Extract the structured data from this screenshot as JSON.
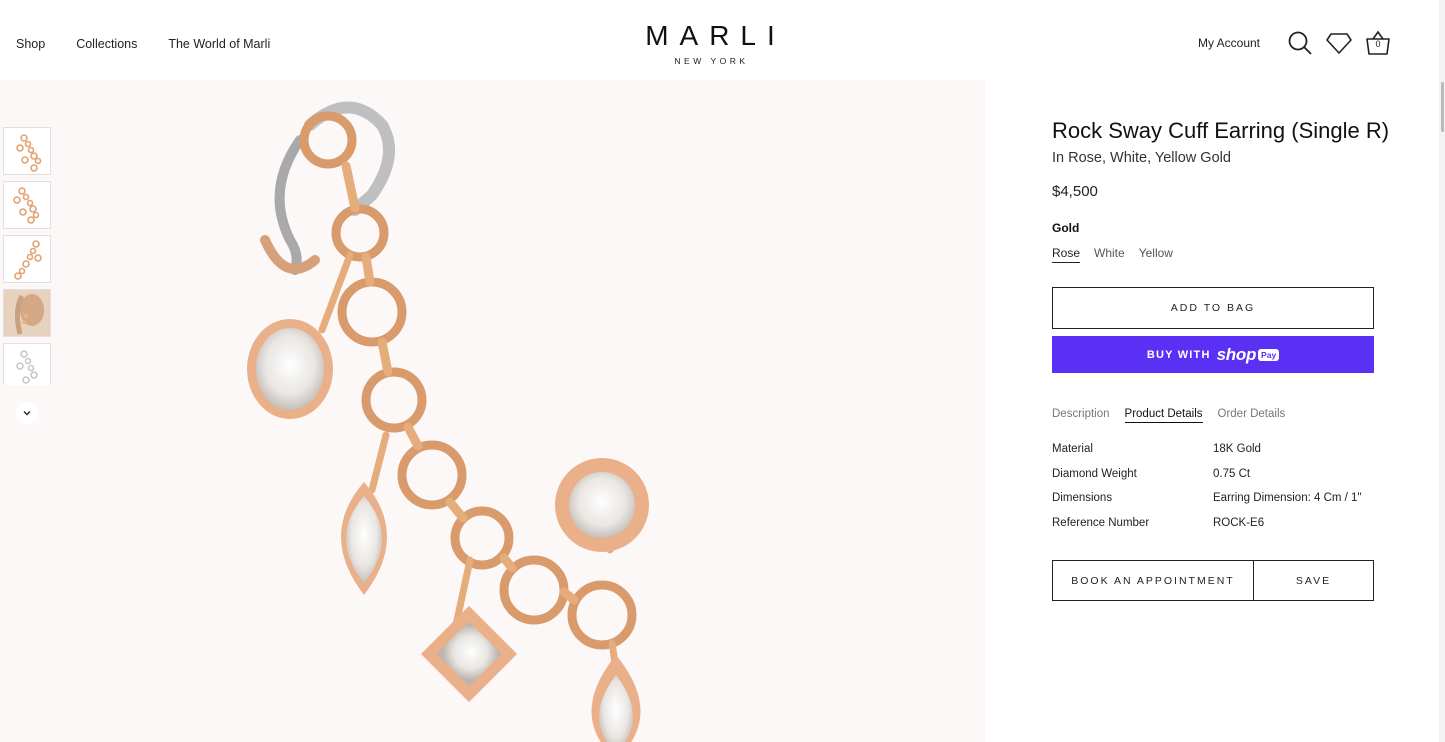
{
  "header": {
    "nav": [
      "Shop",
      "Collections",
      "The World of Marli"
    ],
    "logo": "MARLI",
    "logo_sub": "NEW YORK",
    "my_account": "My Account",
    "cart_count": "0"
  },
  "gallery": {
    "thumbnails": [
      "earring-rose-view",
      "earring-rose-angle",
      "earring-rose-detail",
      "earring-on-model",
      "earring-white-view"
    ],
    "scroll_icon": "chevron-down-icon",
    "main_image": "rock-sway-cuff-earring-rose"
  },
  "product": {
    "title": "Rock Sway Cuff Earring (Single R)",
    "subtitle": "In Rose, White, Yellow Gold",
    "price": "$4,500",
    "variant_label": "Gold",
    "variant_options": [
      "Rose",
      "White",
      "Yellow"
    ],
    "selected_variant": "Rose",
    "add_to_bag": "ADD TO BAG",
    "shop_pay": {
      "prefix": "BUY WITH",
      "brand": "shop",
      "badge": "Pay"
    },
    "tabs": [
      "Description",
      "Product Details",
      "Order Details"
    ],
    "active_tab": "Product Details",
    "details": [
      {
        "label": "Material",
        "value": "18K Gold"
      },
      {
        "label": "Diamond Weight",
        "value": "0.75 Ct"
      },
      {
        "label": "Dimensions",
        "value": "Earring Dimension: 4 Cm / 1\""
      },
      {
        "label": "Reference Number",
        "value": "ROCK-E6"
      }
    ],
    "book_appointment": "BOOK AN APPOINTMENT",
    "save": "SAVE"
  },
  "colors": {
    "shop_pay": "#5a31f4",
    "gallery_bg": "#fcf8f8",
    "rose_gold": "#e2a373"
  }
}
